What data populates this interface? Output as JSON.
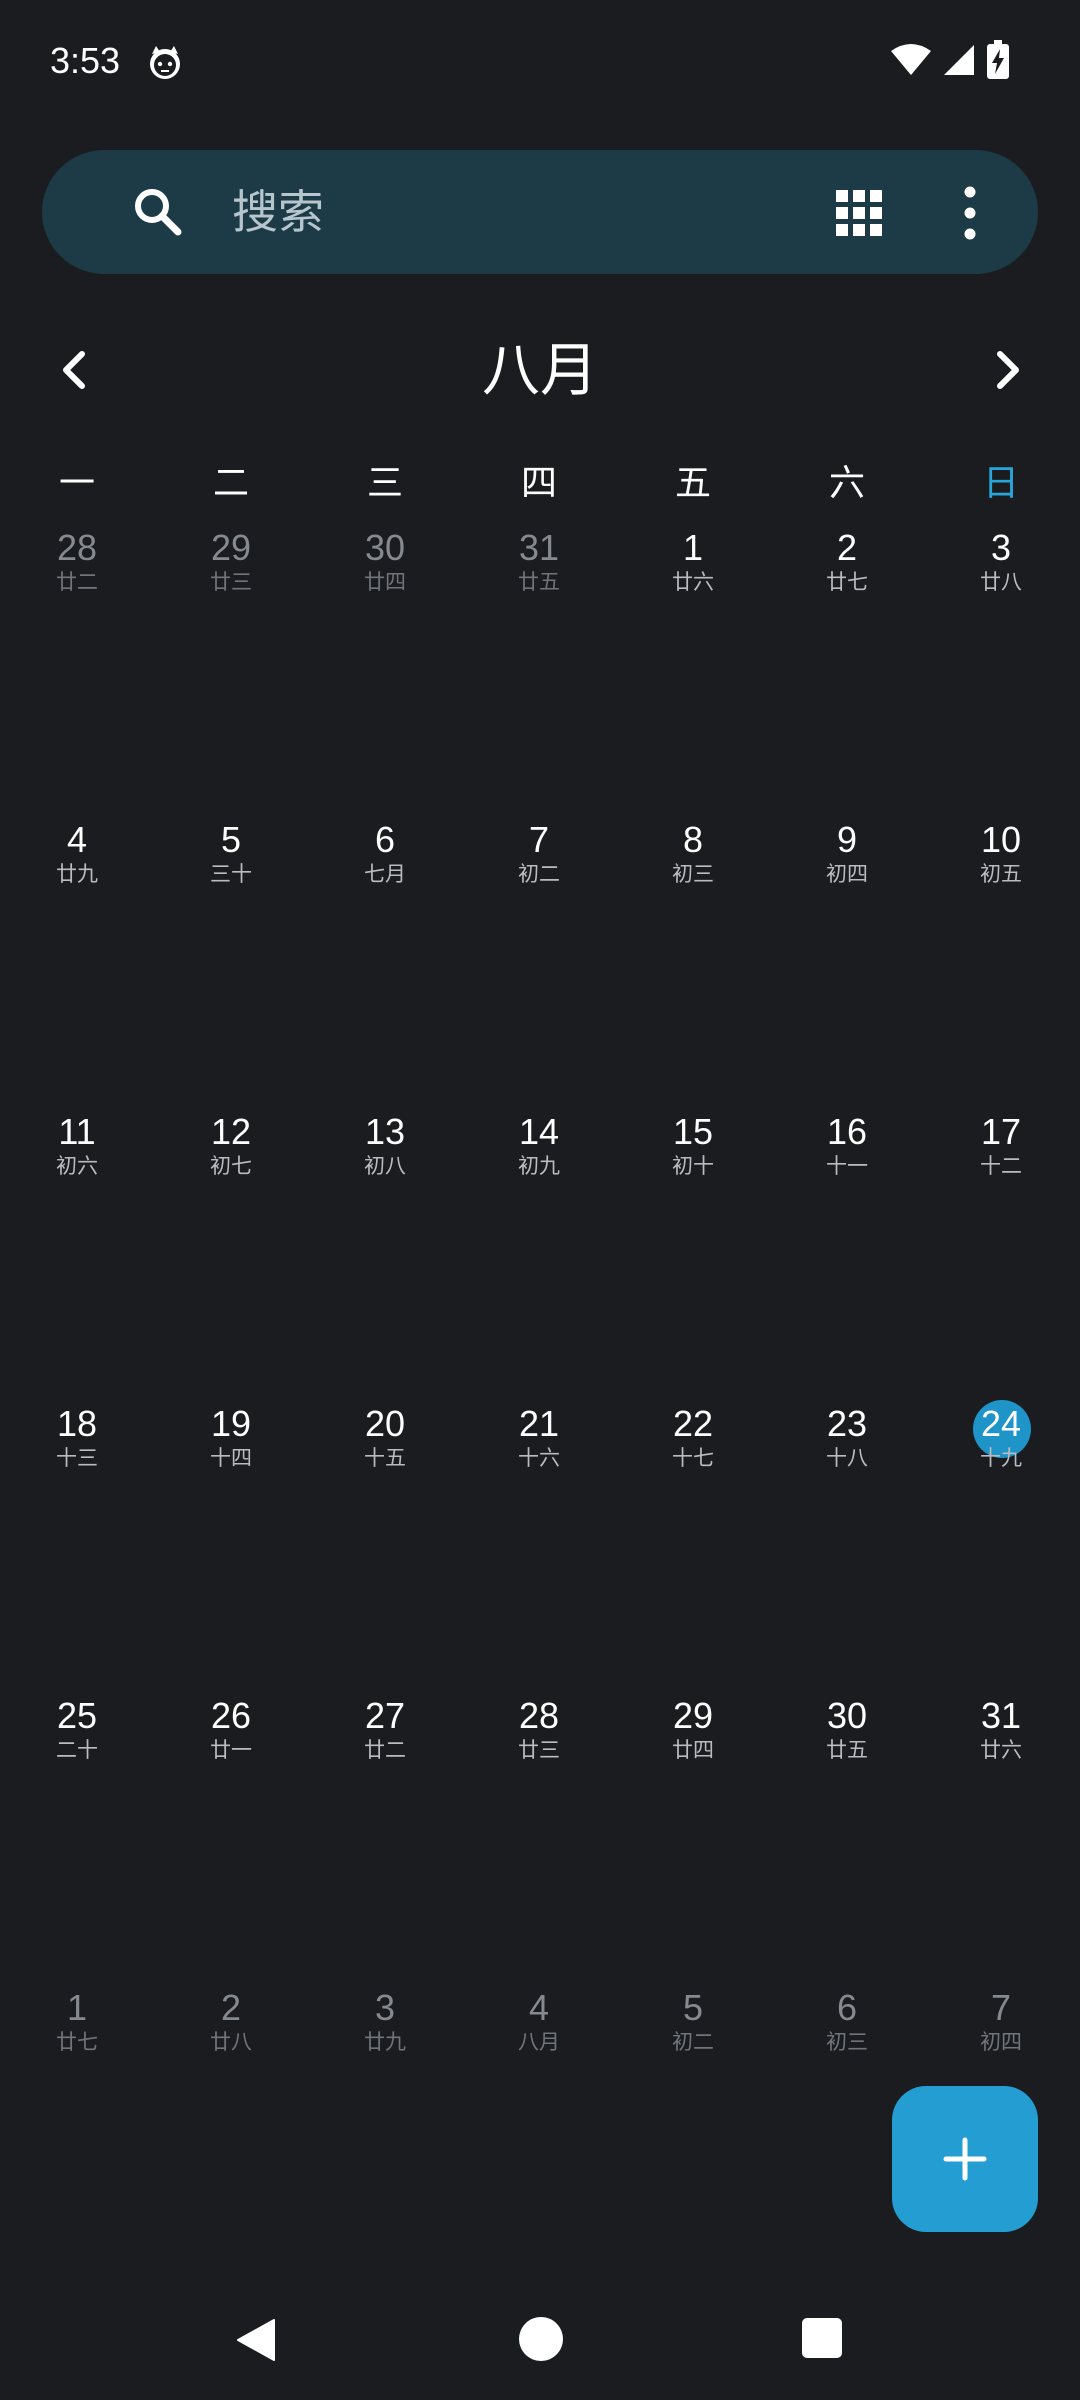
{
  "status_bar": {
    "time": "3:53",
    "icons": [
      "cat-notification-icon",
      "wifi-icon",
      "signal-icon",
      "battery-charging-icon"
    ]
  },
  "search": {
    "placeholder": "搜索"
  },
  "month": {
    "title": "八月"
  },
  "weekdays": [
    "一",
    "二",
    "三",
    "四",
    "五",
    "六",
    "日"
  ],
  "colors": {
    "background": "#1a1c1f",
    "search_bg": "#1c3b47",
    "accent": "#239dd2",
    "sunday": "#28a6db"
  },
  "weeks": [
    [
      {
        "day": "28",
        "lunar": "廿二",
        "other": true
      },
      {
        "day": "29",
        "lunar": "廿三",
        "other": true
      },
      {
        "day": "30",
        "lunar": "廿四",
        "other": true
      },
      {
        "day": "31",
        "lunar": "廿五",
        "other": true
      },
      {
        "day": "1",
        "lunar": "廿六"
      },
      {
        "day": "2",
        "lunar": "廿七"
      },
      {
        "day": "3",
        "lunar": "廿八"
      }
    ],
    [
      {
        "day": "4",
        "lunar": "廿九"
      },
      {
        "day": "5",
        "lunar": "三十"
      },
      {
        "day": "6",
        "lunar": "七月"
      },
      {
        "day": "7",
        "lunar": "初二"
      },
      {
        "day": "8",
        "lunar": "初三"
      },
      {
        "day": "9",
        "lunar": "初四"
      },
      {
        "day": "10",
        "lunar": "初五"
      }
    ],
    [
      {
        "day": "11",
        "lunar": "初六"
      },
      {
        "day": "12",
        "lunar": "初七"
      },
      {
        "day": "13",
        "lunar": "初八"
      },
      {
        "day": "14",
        "lunar": "初九"
      },
      {
        "day": "15",
        "lunar": "初十"
      },
      {
        "day": "16",
        "lunar": "十一"
      },
      {
        "day": "17",
        "lunar": "十二"
      }
    ],
    [
      {
        "day": "18",
        "lunar": "十三"
      },
      {
        "day": "19",
        "lunar": "十四"
      },
      {
        "day": "20",
        "lunar": "十五"
      },
      {
        "day": "21",
        "lunar": "十六"
      },
      {
        "day": "22",
        "lunar": "十七"
      },
      {
        "day": "23",
        "lunar": "十八"
      },
      {
        "day": "24",
        "lunar": "十九",
        "today": true
      }
    ],
    [
      {
        "day": "25",
        "lunar": "二十"
      },
      {
        "day": "26",
        "lunar": "廿一"
      },
      {
        "day": "27",
        "lunar": "廿二"
      },
      {
        "day": "28",
        "lunar": "廿三"
      },
      {
        "day": "29",
        "lunar": "廿四"
      },
      {
        "day": "30",
        "lunar": "廿五"
      },
      {
        "day": "31",
        "lunar": "廿六"
      }
    ],
    [
      {
        "day": "1",
        "lunar": "廿七",
        "other": true
      },
      {
        "day": "2",
        "lunar": "廿八",
        "other": true
      },
      {
        "day": "3",
        "lunar": "廿九",
        "other": true
      },
      {
        "day": "4",
        "lunar": "八月",
        "other": true
      },
      {
        "day": "5",
        "lunar": "初二",
        "other": true
      },
      {
        "day": "6",
        "lunar": "初三",
        "other": true
      },
      {
        "day": "7",
        "lunar": "初四",
        "other": true
      }
    ]
  ],
  "fab": {
    "icon": "plus-icon"
  },
  "nav": {
    "icons": [
      "back-icon",
      "home-icon",
      "recents-icon"
    ]
  }
}
